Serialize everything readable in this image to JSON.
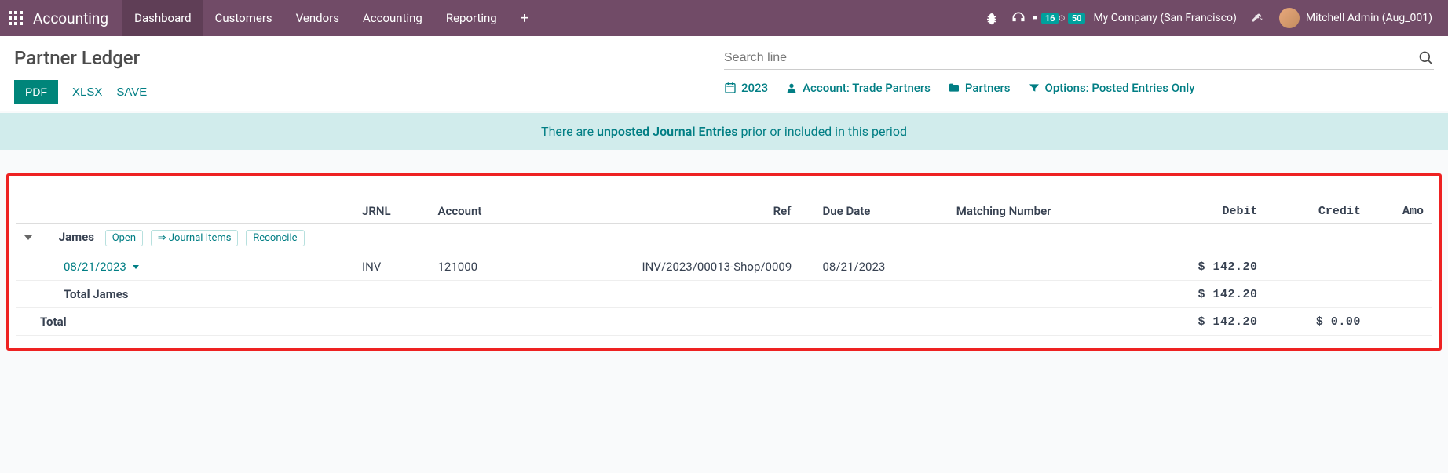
{
  "nav": {
    "brand": "Accounting",
    "menu": [
      "Dashboard",
      "Customers",
      "Vendors",
      "Accounting",
      "Reporting"
    ],
    "active_index": 0,
    "messages_badge": "16",
    "activities_badge": "50",
    "company": "My Company (San Francisco)",
    "user": "Mitchell Admin (Aug_001)"
  },
  "header": {
    "title": "Partner Ledger",
    "pdf": "PDF",
    "xlsx": "XLSX",
    "save": "SAVE",
    "search_placeholder": "Search line"
  },
  "filters": {
    "date": "2023",
    "account": "Account: Trade Partners",
    "partners": "Partners",
    "options": "Options: Posted Entries Only"
  },
  "banner": {
    "pre": "There are ",
    "bold": "unposted Journal Entries",
    "post": " prior or included in this period"
  },
  "table": {
    "headers": {
      "jrnl": "JRNL",
      "account": "Account",
      "ref": "Ref",
      "due": "Due Date",
      "matching": "Matching Number",
      "debit": "Debit",
      "credit": "Credit",
      "amount": "Amo"
    },
    "partner": {
      "name": "James",
      "open": "Open",
      "journal_items": "⇒ Journal Items",
      "reconcile": "Reconcile"
    },
    "line": {
      "date": "08/21/2023",
      "jrnl": "INV",
      "account": "121000",
      "ref": "INV/2023/00013-Shop/0009",
      "due": "08/21/2023",
      "debit": "$ 142.20"
    },
    "partner_total": {
      "label": "Total James",
      "debit": "$ 142.20"
    },
    "grand_total": {
      "label": "Total",
      "debit": "$ 142.20",
      "credit": "$ 0.00"
    }
  }
}
